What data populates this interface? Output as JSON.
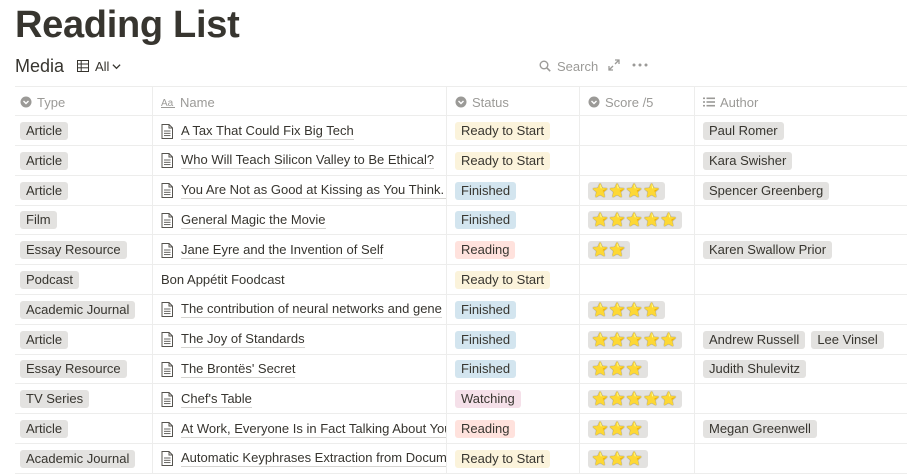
{
  "page": {
    "title": "Reading List"
  },
  "toolbar": {
    "db_name": "Media",
    "view_label": "All",
    "search_label": "Search"
  },
  "columns": {
    "type": "Type",
    "name": "Name",
    "status": "Status",
    "score": "Score /5",
    "author": "Author"
  },
  "rows": [
    {
      "type": "Article",
      "name": "A Tax That Could Fix Big Tech",
      "status": "Ready to Start",
      "stars": "",
      "authors": [
        "Paul Romer"
      ]
    },
    {
      "type": "Article",
      "name": "Who Will Teach Silicon Valley to Be Ethical?",
      "status": "Ready to Start",
      "stars": "",
      "authors": [
        "Kara Swisher"
      ]
    },
    {
      "type": "Article",
      "name": "You Are Not as Good at Kissing as You Think. E",
      "status": "Finished",
      "stars": "⭐⭐⭐⭐",
      "authors": [
        "Spencer Greenberg"
      ]
    },
    {
      "type": "Film",
      "name": "General Magic the Movie",
      "status": "Finished",
      "stars": "⭐⭐⭐⭐⭐",
      "authors": []
    },
    {
      "type": "Essay Resource",
      "name": "Jane Eyre and the Invention of Self",
      "status": "Reading",
      "stars": "⭐⭐",
      "authors": [
        "Karen Swallow Prior"
      ]
    },
    {
      "type": "Podcast",
      "name": "Bon Appétit Foodcast",
      "status": "Ready to Start",
      "stars": "",
      "authors": []
    },
    {
      "type": "Academic Journal",
      "name": "The contribution of neural networks and gene",
      "status": "Finished",
      "stars": "⭐⭐⭐⭐",
      "authors": []
    },
    {
      "type": "Article",
      "name": "The Joy of Standards",
      "status": "Finished",
      "stars": "⭐⭐⭐⭐⭐",
      "authors": [
        "Andrew Russell",
        "Lee Vinsel"
      ]
    },
    {
      "type": "Essay Resource",
      "name": "The Brontës' Secret",
      "status": "Finished",
      "stars": "⭐⭐⭐",
      "authors": [
        "Judith Shulevitz"
      ]
    },
    {
      "type": "TV Series",
      "name": "Chef's Table",
      "status": "Watching",
      "stars": "⭐⭐⭐⭐⭐",
      "authors": []
    },
    {
      "type": "Article",
      "name": "At Work, Everyone Is in Fact Talking About You",
      "status": "Reading",
      "stars": "⭐⭐⭐",
      "authors": [
        "Megan Greenwell"
      ]
    },
    {
      "type": "Academic Journal",
      "name": "Automatic Keyphrases Extraction from Docum",
      "status": "Ready to Start",
      "stars": "⭐⭐⭐",
      "authors": []
    }
  ],
  "colors": {
    "text": "#37352f",
    "muted": "#9b9a97",
    "tag_gray": "#e3e2e0",
    "status_ready": "#fbf3db",
    "status_finished": "#d3e5ef",
    "status_reading": "#ffe2dd",
    "status_watching": "#f5e0e9",
    "star": "#f2c12e"
  }
}
